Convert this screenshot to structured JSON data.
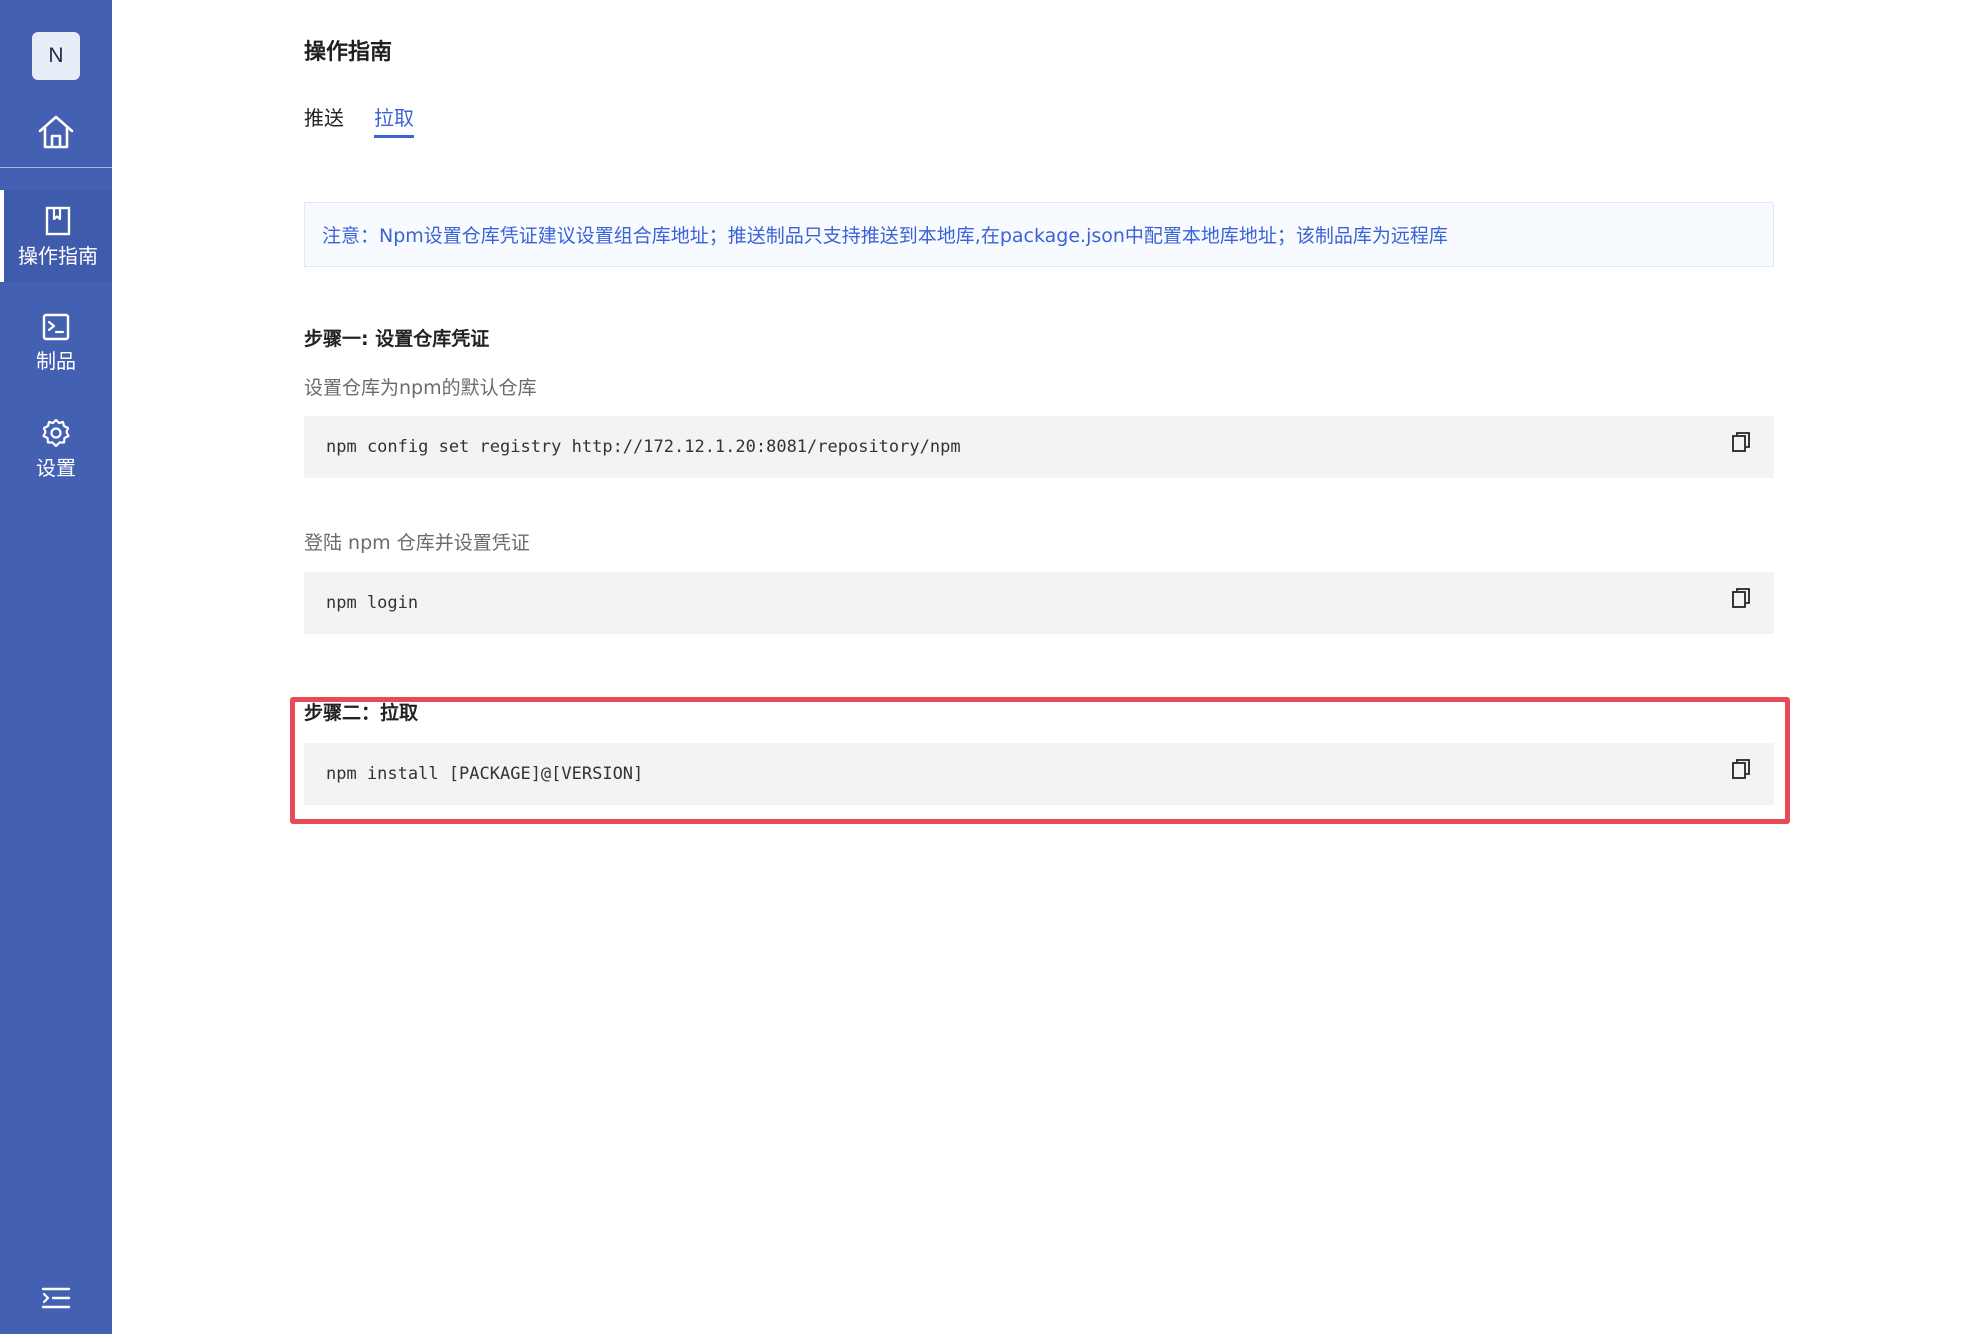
{
  "sidebar": {
    "avatar_text": "N",
    "items": [
      {
        "label": "操作指南",
        "icon": "book-icon",
        "active": true
      },
      {
        "label": "制品",
        "icon": "terminal-icon",
        "active": false
      },
      {
        "label": "设置",
        "icon": "gear-icon",
        "active": false
      }
    ],
    "color": "#4360b3"
  },
  "main": {
    "title": "操作指南",
    "tabs": [
      {
        "label": "推送",
        "active": false
      },
      {
        "label": "拉取",
        "active": true
      }
    ],
    "notice": "注意：Npm设置仓库凭证建议设置组合库地址；推送制品只支持推送到本地库,在package.json中配置本地库地址；该制品库为远程库",
    "step1": {
      "title": "步骤一: 设置仓库凭证",
      "desc1": "设置仓库为npm的默认仓库",
      "code1": "npm config set registry http://172.12.1.20:8081/repository/npm",
      "desc2": "登陆 npm 仓库并设置凭证",
      "code2": "npm login"
    },
    "step2": {
      "title": "步骤二：拉取",
      "code": "npm install [PACKAGE]@[VERSION]"
    }
  },
  "colors": {
    "accent": "#3b62d6",
    "highlight": "#e84a57"
  }
}
